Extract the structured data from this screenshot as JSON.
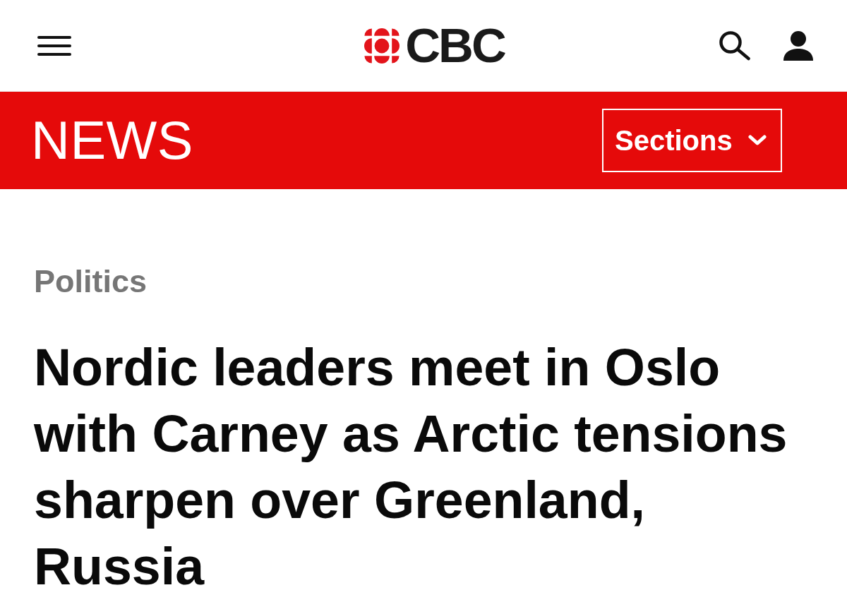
{
  "header": {
    "logo": "CBC"
  },
  "section_bar": {
    "title": "NEWS",
    "sections_button": "Sections"
  },
  "article": {
    "category": "Politics",
    "headline": "Nordic leaders meet in Oslo with Carney as Arctic tensions sharpen over Greenland, Russia"
  }
}
